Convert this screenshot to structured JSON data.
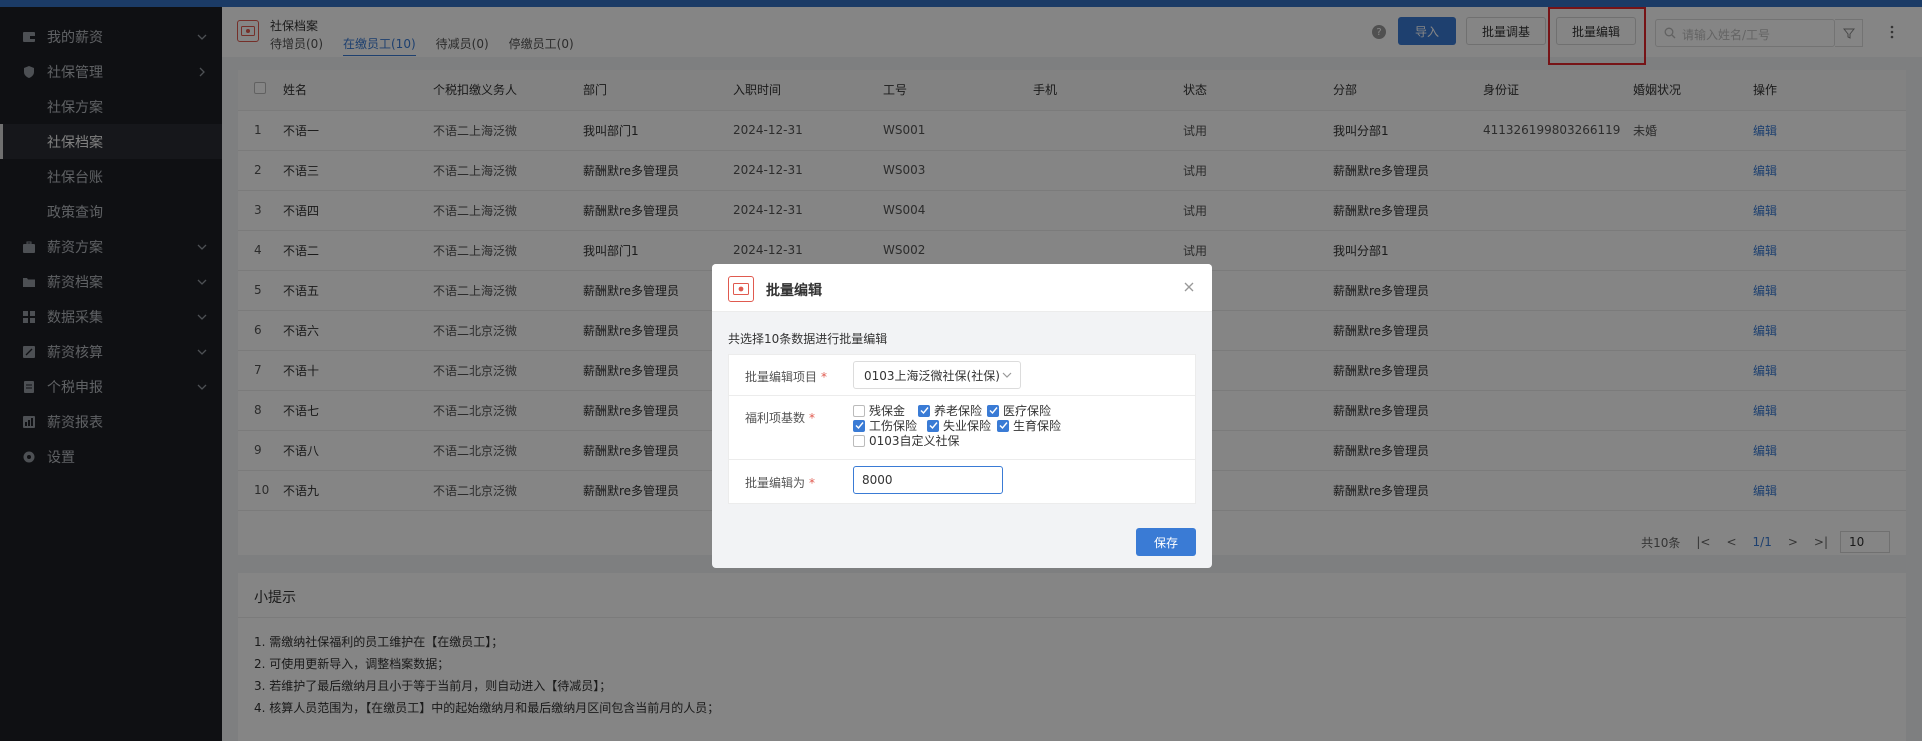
{
  "sidebar": {
    "items": [
      {
        "label": "我的薪资",
        "icon": "wallet-icon",
        "chevron": "down"
      },
      {
        "label": "社保管理",
        "icon": "shield-icon",
        "chevron": "right"
      },
      {
        "label": "社保方案",
        "sub": true
      },
      {
        "label": "社保档案",
        "sub": true,
        "active": true
      },
      {
        "label": "社保台账",
        "sub": true
      },
      {
        "label": "政策查询",
        "sub": true
      },
      {
        "label": "薪资方案",
        "icon": "briefcase-icon",
        "chevron": "down"
      },
      {
        "label": "薪资档案",
        "icon": "folder-icon",
        "chevron": "down"
      },
      {
        "label": "数据采集",
        "icon": "data-icon",
        "chevron": "down"
      },
      {
        "label": "薪资核算",
        "icon": "calculator-icon",
        "chevron": "down"
      },
      {
        "label": "个税申报",
        "icon": "tax-icon",
        "chevron": "down"
      },
      {
        "label": "薪资报表",
        "icon": "report-icon"
      },
      {
        "label": "设置",
        "icon": "gear-icon"
      }
    ]
  },
  "header": {
    "title": "社保档案",
    "tabs": [
      "待增员(0)",
      "在缴员工(10)",
      "待减员(0)",
      "停缴员工(0)"
    ],
    "import_label": "导入",
    "batch_adjust_label": "批量调基",
    "batch_edit_label": "批量编辑",
    "search_placeholder": "请输入姓名/工号"
  },
  "table": {
    "columns": [
      "姓名",
      "个税扣缴义务人",
      "部门",
      "入职时间",
      "工号",
      "手机",
      "状态",
      "分部",
      "身份证",
      "婚姻状况",
      "操作"
    ],
    "rows": [
      {
        "no": "1",
        "name": "不语一",
        "agent": "不语二上海泛微",
        "dept": "我叫部门1",
        "date": "2024-12-31",
        "id": "WS001",
        "phone": "",
        "status": "试用",
        "branch": "我叫分部1",
        "idcard": "411326199803266119",
        "marital": "未婚",
        "op": "编辑"
      },
      {
        "no": "2",
        "name": "不语三",
        "agent": "不语二上海泛微",
        "dept": "薪酬默re多管理员",
        "date": "2024-12-31",
        "id": "WS003",
        "phone": "",
        "status": "试用",
        "branch": "薪酬默re多管理员",
        "idcard": "",
        "marital": "",
        "op": "编辑"
      },
      {
        "no": "3",
        "name": "不语四",
        "agent": "不语二上海泛微",
        "dept": "薪酬默re多管理员",
        "date": "2024-12-31",
        "id": "WS004",
        "phone": "",
        "status": "试用",
        "branch": "薪酬默re多管理员",
        "idcard": "",
        "marital": "",
        "op": "编辑"
      },
      {
        "no": "4",
        "name": "不语二",
        "agent": "不语二上海泛微",
        "dept": "我叫部门1",
        "date": "2024-12-31",
        "id": "WS002",
        "phone": "",
        "status": "试用",
        "branch": "我叫分部1",
        "idcard": "",
        "marital": "",
        "op": "编辑"
      },
      {
        "no": "5",
        "name": "不语五",
        "agent": "不语二上海泛微",
        "dept": "薪酬默re多管理员",
        "date": "",
        "id": "",
        "phone": "",
        "status": "",
        "branch": "薪酬默re多管理员",
        "idcard": "",
        "marital": "",
        "op": "编辑"
      },
      {
        "no": "6",
        "name": "不语六",
        "agent": "不语二北京泛微",
        "dept": "薪酬默re多管理员",
        "date": "",
        "id": "",
        "phone": "",
        "status": "",
        "branch": "薪酬默re多管理员",
        "idcard": "",
        "marital": "",
        "op": "编辑"
      },
      {
        "no": "7",
        "name": "不语十",
        "agent": "不语二北京泛微",
        "dept": "薪酬默re多管理员",
        "date": "",
        "id": "",
        "phone": "",
        "status": "",
        "branch": "薪酬默re多管理员",
        "idcard": "",
        "marital": "",
        "op": "编辑"
      },
      {
        "no": "8",
        "name": "不语七",
        "agent": "不语二北京泛微",
        "dept": "薪酬默re多管理员",
        "date": "",
        "id": "",
        "phone": "",
        "status": "",
        "branch": "薪酬默re多管理员",
        "idcard": "",
        "marital": "",
        "op": "编辑"
      },
      {
        "no": "9",
        "name": "不语八",
        "agent": "不语二北京泛微",
        "dept": "薪酬默re多管理员",
        "date": "",
        "id": "",
        "phone": "",
        "status": "",
        "branch": "薪酬默re多管理员",
        "idcard": "",
        "marital": "",
        "op": "编辑"
      },
      {
        "no": "10",
        "name": "不语九",
        "agent": "不语二北京泛微",
        "dept": "薪酬默re多管理员",
        "date": "",
        "id": "",
        "phone": "",
        "status": "",
        "branch": "薪酬默re多管理员",
        "idcard": "",
        "marital": "",
        "op": "编辑"
      }
    ]
  },
  "pager": {
    "total": "共10条",
    "page": "1/1",
    "size": "10"
  },
  "tips": {
    "title": "小提示",
    "items": [
      "1. 需缴纳社保福利的员工维护在【在缴员工】；",
      "2. 可使用更新导入，调整档案数据；",
      "3. 若维护了最后缴纳月且小于等于当前月，则自动进入【待减员】；",
      "4. 核算人员范围为，【在缴员工】中的起始缴纳月和最后缴纳月区间包含当前月的人员；"
    ]
  },
  "modal": {
    "title": "批量编辑",
    "desc": "共选择10条数据进行批量编辑",
    "item_label": "批量编辑项目",
    "item_value": "0103上海泛微社保(社保)",
    "base_label": "福利项基数",
    "checkboxes": [
      {
        "label": "残保金",
        "checked": false
      },
      {
        "label": "养老保险",
        "checked": true
      },
      {
        "label": "医疗保险",
        "checked": true
      },
      {
        "label": "工伤保险",
        "checked": true
      },
      {
        "label": "失业保险",
        "checked": true
      },
      {
        "label": "生育保险",
        "checked": true
      },
      {
        "label": "0103自定义社保",
        "checked": false
      }
    ],
    "edit_to_label": "批量编辑为",
    "edit_to_value": "8000",
    "required_mark": "*",
    "save_label": "保存"
  },
  "colors": {
    "primary": "#3a7bd5",
    "highlight": "#e3262b",
    "sidebar_bg": "#1f2126"
  }
}
